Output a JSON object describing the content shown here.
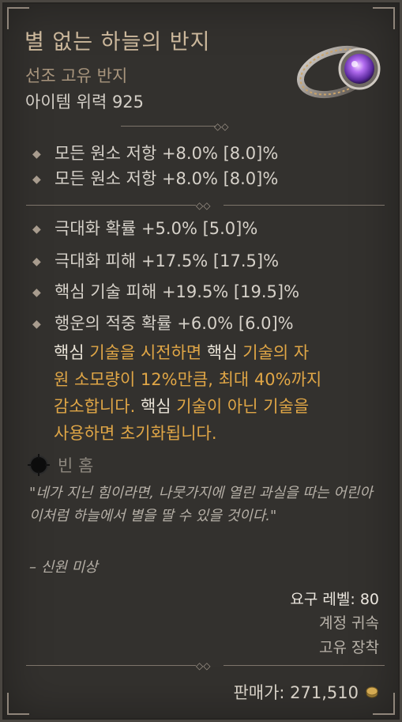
{
  "item": {
    "name": "별 없는 하늘의 반지",
    "type": "선조 고유 반지",
    "power": "아이템 위력 925",
    "colors": {
      "name": "#cbb79b",
      "unique": "#e0a646",
      "text": "#d6d1c9"
    }
  },
  "implicits": [
    "모든 원소 저항 +8.0% [8.0]%",
    "모든 원소 저항 +8.0% [8.0]%"
  ],
  "affixes": [
    "극대화 확률 +5.0% [5.0]%",
    "극대화 피해 +17.5% [17.5]%",
    "핵심 기술 피해 +19.5% [19.5]%",
    "행운의 적중 확률 +6.0% [6.0]%"
  ],
  "unique_power": {
    "lines": [
      [
        "핵심 ",
        "기술을 시전하면 ",
        "핵심 ",
        "기술의 자"
      ],
      [
        "원 소모량이 12%만큼, 최대 40%까지",
        "",
        "",
        ""
      ],
      [
        "감소합니다. ",
        "핵심 ",
        "기술이 아닌 기술을",
        ""
      ],
      [
        "사용하면 초기화됩니다.",
        "",
        "",
        ""
      ]
    ]
  },
  "socket": {
    "label": "빈 홈",
    "icon": "empty-socket-icon"
  },
  "flavor": {
    "quote": "\"네가 지닌 힘이라면, 나뭇가지에 열린 과실을 따는 어린아이처럼 하늘에서 별을 딸 수 있을 것이다.\"",
    "author": "– 신원 미상"
  },
  "requirements": {
    "level": "요구 레벨: 80",
    "account_bound": "계정 귀속",
    "unique_equipped": "고유 장착"
  },
  "sell": {
    "label": "판매가: 271,510",
    "icon": "gold-coin-icon"
  }
}
